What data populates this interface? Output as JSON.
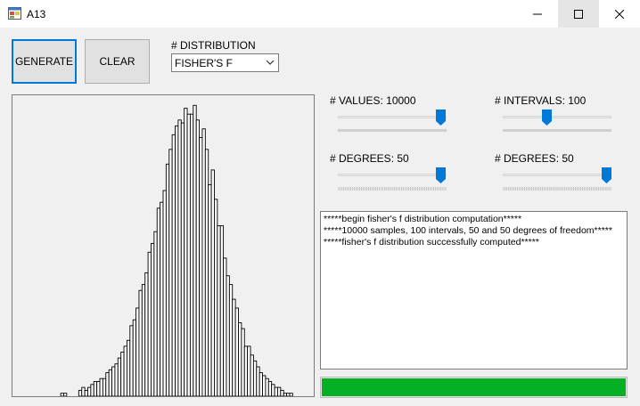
{
  "window": {
    "title": "A13"
  },
  "buttons": {
    "generate": "GENERATE",
    "clear": "CLEAR"
  },
  "distribution": {
    "label": "# DISTRIBUTION",
    "selected": "FISHER'S F"
  },
  "sliders": {
    "values": {
      "label": "# VALUES: 10000",
      "level": 0.99
    },
    "intervals": {
      "label": "# INTERVALS: 100",
      "level": 0.4
    },
    "degrees1": {
      "label": "# DEGREES: 50",
      "level": 0.99
    },
    "degrees2": {
      "label": "# DEGREES: 50",
      "level": 1.0
    }
  },
  "log": {
    "lines": [
      "*****begin fisher's f distribution computation*****",
      "*****10000 samples, 100 intervals, 50 and 50 degrees of freedom*****",
      "*****fisher's f distribution successfully computed*****"
    ]
  },
  "progress": {
    "level": 1.0,
    "color": "#06b025"
  },
  "chart_data": {
    "type": "bar",
    "title": "",
    "xlabel": "",
    "ylabel": "",
    "values": [
      0,
      0,
      0,
      0,
      0,
      0,
      0,
      0,
      0,
      0,
      0,
      0,
      0,
      0,
      0,
      0,
      1,
      1,
      0,
      0,
      0,
      0,
      2,
      3,
      2,
      3,
      4,
      5,
      5,
      6,
      6,
      8,
      9,
      10,
      11,
      13,
      15,
      17,
      19,
      24,
      26,
      30,
      36,
      38,
      42,
      49,
      52,
      56,
      64,
      66,
      70,
      79,
      84,
      89,
      92,
      94,
      93,
      98,
      96,
      96,
      99,
      94,
      88,
      91,
      84,
      72,
      77,
      67,
      58,
      58,
      47,
      41,
      38,
      33,
      30,
      25,
      23,
      17,
      17,
      14,
      12,
      10,
      8,
      7,
      6,
      5,
      4,
      3,
      3,
      2,
      1,
      1,
      1,
      0,
      0,
      0,
      0,
      0,
      0,
      0
    ],
    "ylim": [
      0,
      100
    ]
  }
}
